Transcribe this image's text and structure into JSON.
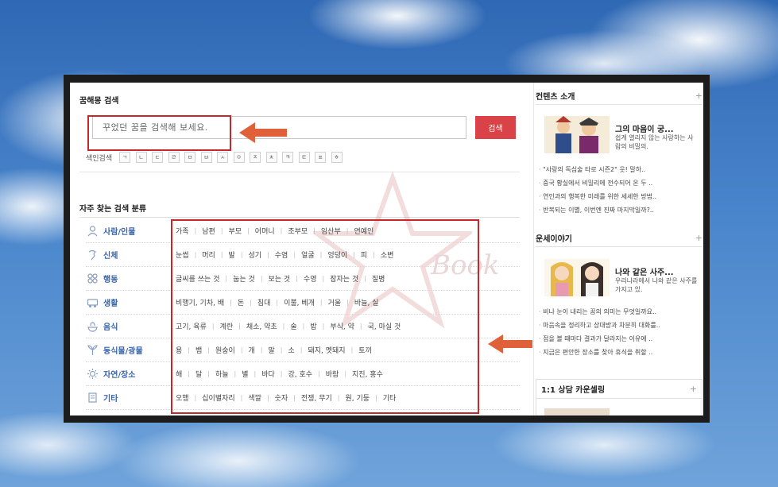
{
  "search": {
    "section_title": "꿈해몽 검색",
    "placeholder": "꾸었던 꿈을 검색해 보세요.",
    "button_label": "검색",
    "index_label": "색인검색",
    "index_chars": [
      "ㄱ",
      "ㄴ",
      "ㄷ",
      "ㄹ",
      "ㅁ",
      "ㅂ",
      "ㅅ",
      "ㅇ",
      "ㅈ",
      "ㅊ",
      "ㅋ",
      "ㅌ",
      "ㅍ",
      "ㅎ"
    ]
  },
  "categories": {
    "section_title": "자주 찾는 검색 분류",
    "rows": [
      {
        "name": "사람/인물",
        "icon": "person-icon",
        "items": [
          "가족",
          "남편",
          "부모",
          "어머니",
          "조부모",
          "임산부",
          "연예인"
        ]
      },
      {
        "name": "신체",
        "icon": "body-icon",
        "items": [
          "눈썹",
          "머리",
          "발",
          "성기",
          "수염",
          "얼굴",
          "엉덩이",
          "피",
          "소변"
        ]
      },
      {
        "name": "행동",
        "icon": "action-icon",
        "items": [
          "글씨를 쓰는 것",
          "눕는 것",
          "보는 것",
          "수영",
          "잠자는 것",
          "질병"
        ]
      },
      {
        "name": "생활",
        "icon": "car-icon",
        "items": [
          "비행기, 기차, 배",
          "돈",
          "침대",
          "이불, 베개",
          "거울",
          "바늘, 실"
        ]
      },
      {
        "name": "음식",
        "icon": "food-icon",
        "items": [
          "고기, 육류",
          "계란",
          "채소, 약초",
          "술",
          "밥",
          "부식, 약",
          "국, 마실 것"
        ]
      },
      {
        "name": "동식물/광물",
        "icon": "plant-icon",
        "items": [
          "용",
          "뱀",
          "원숭이",
          "개",
          "말",
          "소",
          "돼지, 멧돼지",
          "토끼"
        ]
      },
      {
        "name": "자연/장소",
        "icon": "sun-icon",
        "items": [
          "해",
          "달",
          "하늘",
          "별",
          "바다",
          "강, 호수",
          "바람",
          "지진, 홍수"
        ]
      },
      {
        "name": "기타",
        "icon": "book-icon",
        "items": [
          "오행",
          "십이별자리",
          "색깔",
          "숫자",
          "전쟁, 무기",
          "원, 기둥",
          "기타"
        ]
      }
    ]
  },
  "sidebar": {
    "contents": {
      "title": "컨텐츠 소개",
      "plus": "+",
      "feature_title": "그의 마음이 궁...",
      "feature_desc": "쉽게 열리지 않는 사랑하는 사람의 비밀의.",
      "bullets": [
        "\"사랑의 독심술 타로 시즌2\" 웃! 말하..",
        "중국 황실에서 비밀리에 전수되어 온 두 ..",
        "연인과의 행복한 미래를 위한 세세한 방법..",
        "반복되는 이별, 이번엔 진짜 마지막일까?.."
      ]
    },
    "fortune": {
      "title": "운세이야기",
      "plus": "+",
      "feature_title": "나와 같은 사주...",
      "feature_desc": "우리나라에서 나와 같은 사주를 가지고 있.",
      "bullets": [
        "비나 눈이 내리는 꿈의 의미는 무엇일까요..",
        "마음속을 정리하고 상대방과 차분히 대화를..",
        "점을 볼 때마다 결과가 달라지는 이유에 ..",
        "지금은 편안한 장소를 찾아 휴식을 취할 .."
      ]
    },
    "counsel": {
      "title": "1:1 상담 카운셀링",
      "plus": "+"
    }
  },
  "watermark_text": "Book",
  "colors": {
    "accent_red": "#d94247",
    "highlight_red": "#c9262c",
    "arrow_orange": "#e0603a",
    "category_blue": "#3a65a8"
  }
}
